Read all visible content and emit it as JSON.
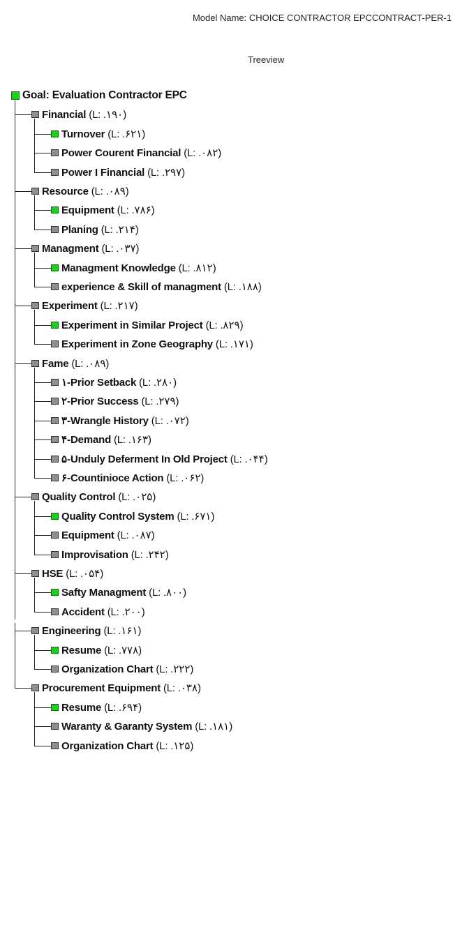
{
  "header": {
    "model_name": "Model Name: CHOICE CONTRACTOR EPCCONTRACT-PER-1",
    "treeview_title": "Treeview"
  },
  "tree": {
    "root": {
      "label": "Goal: Evaluation Contractor EPC",
      "icon": "green-square-icon"
    },
    "criteria": [
      {
        "name": "Financial",
        "weight": "(L: .۱۹۰)",
        "icon": "gray-square-icon",
        "children": [
          {
            "name": "Turnover",
            "weight": "(L: .۶۲۱)",
            "icon": "green-square-icon"
          },
          {
            "name": "Power Courent Financial",
            "weight": "(L: .۰۸۲)",
            "icon": "gray-square-icon"
          },
          {
            "name": "Power I Financial",
            "weight": "(L: .۲۹۷)",
            "icon": "gray-square-icon"
          }
        ]
      },
      {
        "name": "Resource",
        "weight": "(L: .۰۸۹)",
        "icon": "gray-square-icon",
        "children": [
          {
            "name": "Equipment",
            "weight": "(L: .۷۸۶)",
            "icon": "green-square-icon"
          },
          {
            "name": "Planing",
            "weight": "(L: .۲۱۴)",
            "icon": "gray-square-icon"
          }
        ]
      },
      {
        "name": "Managment",
        "weight": "(L: .۰۳۷)",
        "icon": "gray-square-icon",
        "children": [
          {
            "name": "Managment Knowledge",
            "weight": "(L: .۸۱۲)",
            "icon": "green-square-icon"
          },
          {
            "name": "experience & Skill of managment",
            "weight": "(L: .۱۸۸)",
            "icon": "gray-square-icon"
          }
        ]
      },
      {
        "name": "Experiment",
        "weight": "(L: .۲۱۷)",
        "icon": "gray-square-icon",
        "children": [
          {
            "name": "Experiment in Similar Project",
            "weight": "(L: .۸۲۹)",
            "icon": "green-square-icon"
          },
          {
            "name": "Experiment in Zone Geography",
            "weight": "(L: .۱۷۱)",
            "icon": "gray-square-icon"
          }
        ]
      },
      {
        "name": "Fame",
        "weight": "(L: .۰۸۹)",
        "icon": "gray-square-icon",
        "children": [
          {
            "name": "۱-Prior Setback",
            "weight": "(L: .۲۸۰)",
            "icon": "gray-square-icon"
          },
          {
            "name": "۲-Prior Success",
            "weight": "(L: .۲۷۹)",
            "icon": "gray-square-icon"
          },
          {
            "name": "۳-Wrangle History",
            "weight": "(L: .۰۷۲)",
            "icon": "gray-square-icon"
          },
          {
            "name": "۴-Demand",
            "weight": "(L: .۱۶۳)",
            "icon": "gray-square-icon"
          },
          {
            "name": "۵-Unduly Deferment In Old Project",
            "weight": "(L: .۰۴۴)",
            "icon": "gray-square-icon"
          },
          {
            "name": "۶-Countinioce Action",
            "weight": "(L: .۰۶۲)",
            "icon": "gray-square-icon"
          }
        ]
      },
      {
        "name": "Quality Control",
        "weight": "(L: .۰۲۵)",
        "icon": "gray-square-icon",
        "children": [
          {
            "name": "Quality Control System",
            "weight": "(L: .۶۷۱)",
            "icon": "green-square-icon"
          },
          {
            "name": "Equipment",
            "weight": "(L: .۰۸۷)",
            "icon": "gray-square-icon"
          },
          {
            "name": "Improvisation",
            "weight": "(L: .۲۴۲)",
            "icon": "gray-square-icon"
          }
        ]
      },
      {
        "name": "HSE",
        "weight": "(L: .۰۵۴)",
        "icon": "gray-square-icon",
        "children": [
          {
            "name": "Safty Managment",
            "weight": "(L: .۸۰۰)",
            "icon": "green-square-icon"
          },
          {
            "name": "Accident",
            "weight": "(L: .۲۰۰)",
            "icon": "gray-square-icon"
          }
        ]
      },
      {
        "name": "Engineering",
        "weight": "(L: .۱۶۱)",
        "icon": "gray-square-icon",
        "children": [
          {
            "name": "Resume",
            "weight": "(L: .۷۷۸)",
            "icon": "green-square-icon"
          },
          {
            "name": "Organization Chart",
            "weight": "(L: .۲۲۲)",
            "icon": "gray-square-icon"
          }
        ]
      },
      {
        "name": "Procurement Equipment",
        "weight": "(L: .۰۳۸)",
        "icon": "gray-square-icon",
        "children": [
          {
            "name": "Resume",
            "weight": "(L: .۶۹۴)",
            "icon": "green-square-icon"
          },
          {
            "name": "Waranty & Garanty System",
            "weight": "(L: .۱۸۱)",
            "icon": "gray-square-icon"
          },
          {
            "name": "Organization Chart",
            "weight": "(L: .۱۲۵)",
            "icon": "gray-square-icon"
          }
        ]
      }
    ]
  },
  "colors": {
    "highlight_node": "#1ed01e",
    "normal_node": "#8f8f8f",
    "connector": "#222222"
  }
}
